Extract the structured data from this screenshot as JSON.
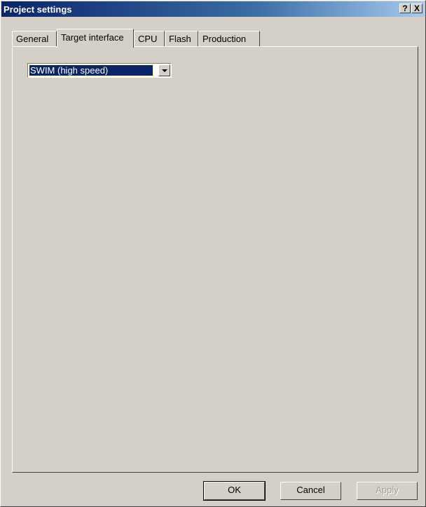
{
  "window": {
    "title": "Project settings",
    "help_label": "?",
    "close_label": "X"
  },
  "tabs": [
    {
      "label": "General",
      "active": false
    },
    {
      "label": "Target interface",
      "active": true
    },
    {
      "label": "CPU",
      "active": false
    },
    {
      "label": "Flash",
      "active": false
    },
    {
      "label": "Production",
      "active": false
    }
  ],
  "target_interface": {
    "selected": "SWIM (high speed)"
  },
  "buttons": {
    "ok": "OK",
    "cancel": "Cancel",
    "apply": "Apply"
  },
  "colors": {
    "selection_bg": "#0a246a",
    "dialog_bg": "#d4d0c8"
  }
}
